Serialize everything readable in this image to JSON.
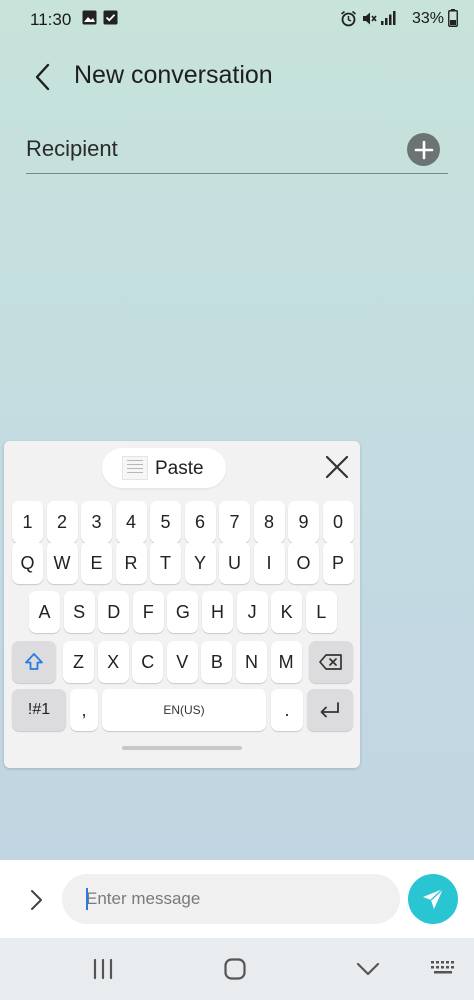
{
  "status_bar": {
    "time": "11:30",
    "battery_text": "33%",
    "left_icons": [
      "image-icon",
      "check-box-icon"
    ],
    "right_icons": [
      "alarm-icon",
      "mute-icon",
      "signal-icon",
      "battery-icon"
    ]
  },
  "header": {
    "title": "New conversation",
    "back_icon": "chevron-left-icon"
  },
  "recipient": {
    "placeholder": "Recipient",
    "add_icon": "plus-icon"
  },
  "keyboard": {
    "paste_label": "Paste",
    "close_icon": "close-icon",
    "rows": {
      "numbers": [
        "1",
        "2",
        "3",
        "4",
        "5",
        "6",
        "7",
        "8",
        "9",
        "0"
      ],
      "row1": [
        "Q",
        "W",
        "E",
        "R",
        "T",
        "Y",
        "U",
        "I",
        "O",
        "P"
      ],
      "row2": [
        "A",
        "S",
        "D",
        "F",
        "G",
        "H",
        "J",
        "K",
        "L"
      ],
      "row3": [
        "Z",
        "X",
        "C",
        "V",
        "B",
        "N",
        "M"
      ]
    },
    "shift_icon": "shift-icon",
    "backspace_icon": "backspace-icon",
    "symbols_label": "!#1",
    "comma_label": ",",
    "space_label": "EN(US)",
    "period_label": ".",
    "enter_icon": "enter-icon"
  },
  "message_bar": {
    "placeholder": "Enter message",
    "expand_icon": "chevron-right-icon",
    "send_icon": "send-icon",
    "accent_color": "#29c5d3"
  },
  "nav_bar": {
    "icons": [
      "recent-apps-icon",
      "home-icon",
      "back-icon",
      "keyboard-icon"
    ]
  }
}
